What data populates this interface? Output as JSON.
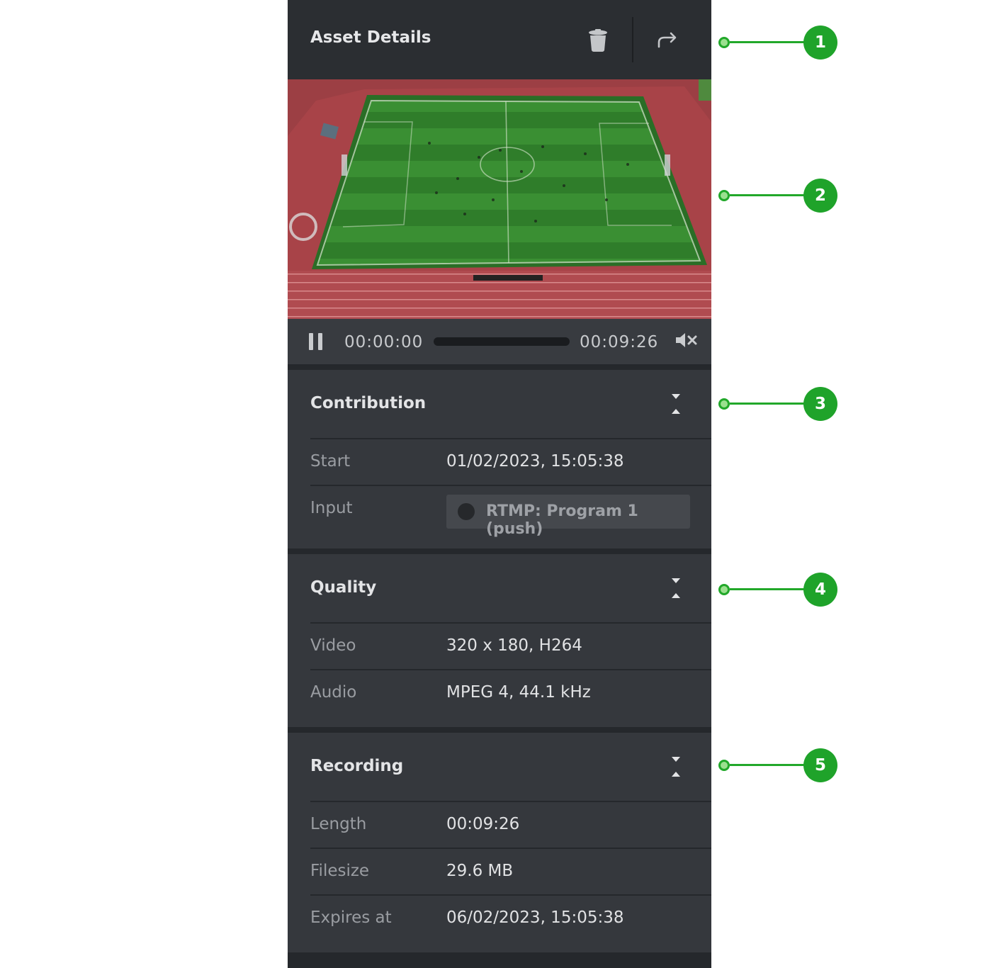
{
  "header": {
    "title": "Asset Details",
    "delete_icon": "trash-icon",
    "share_icon": "share-arrow-icon"
  },
  "player": {
    "current_time": "00:00:00",
    "total_time": "00:09:26",
    "progress": 0,
    "pause_icon": "pause-icon",
    "mute_icon": "mute-icon"
  },
  "contribution": {
    "title": "Contribution",
    "rows": [
      {
        "label": "Start",
        "value": "01/02/2023, 15:05:38"
      },
      {
        "label": "Input",
        "value": "RTMP: Program 1 (push)"
      }
    ]
  },
  "quality": {
    "title": "Quality",
    "rows": [
      {
        "label": "Video",
        "value": "320 x 180, H264"
      },
      {
        "label": "Audio",
        "value": "MPEG 4, 44.1 kHz"
      }
    ]
  },
  "recording": {
    "title": "Recording",
    "rows": [
      {
        "label": "Length",
        "value": "00:09:26"
      },
      {
        "label": "Filesize",
        "value": "29.6 MB"
      },
      {
        "label": "Expires at",
        "value": "06/02/2023, 15:05:38"
      }
    ]
  },
  "callouts": [
    "1",
    "2",
    "3",
    "4",
    "5"
  ],
  "colors": {
    "panel": "#25282c",
    "section": "#35383d",
    "callout_green": "#1fa32a"
  }
}
